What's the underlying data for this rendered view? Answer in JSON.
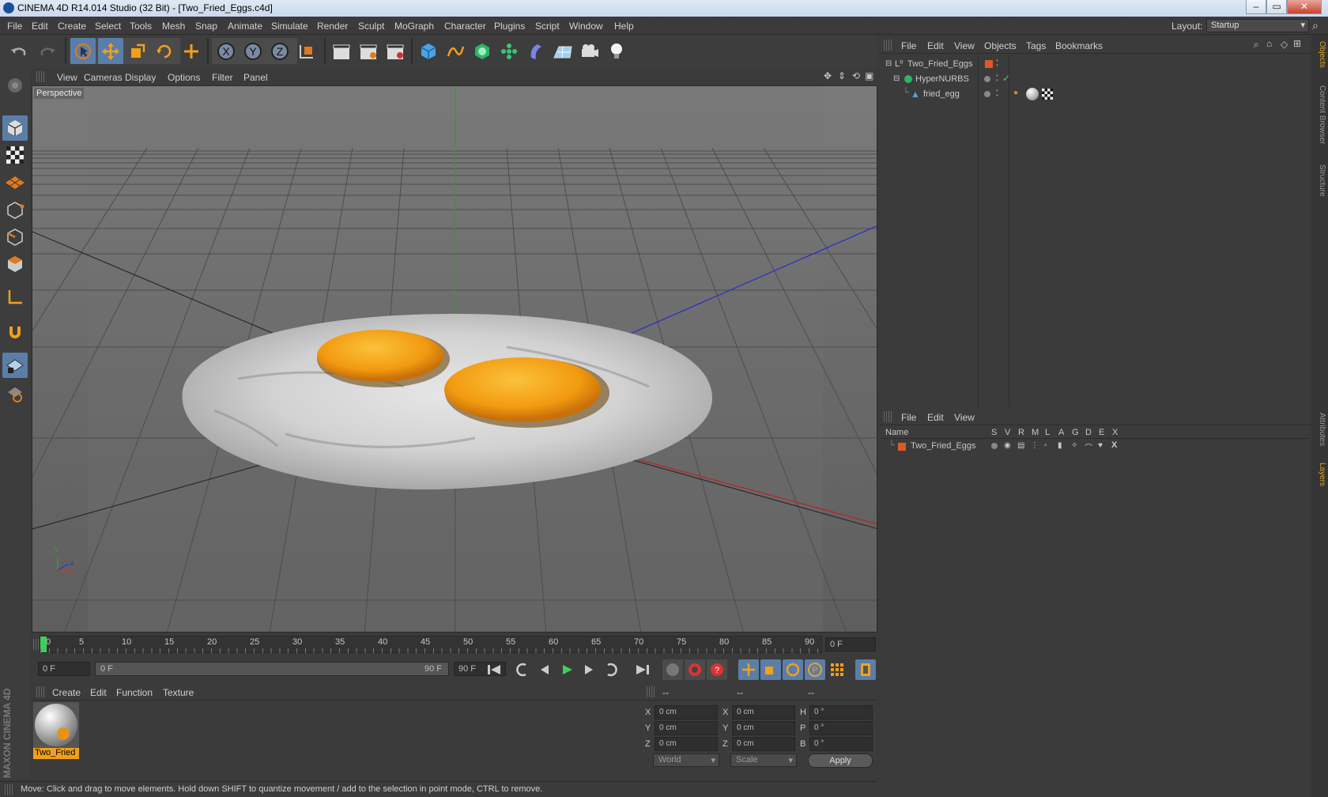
{
  "window": {
    "title": "CINEMA 4D R14.014 Studio (32 Bit) - [Two_Fried_Eggs.c4d]",
    "min": "–",
    "max": "▭",
    "close": "✕"
  },
  "menubar": {
    "items": [
      "File",
      "Edit",
      "Create",
      "Select",
      "Tools",
      "Mesh",
      "Snap",
      "Animate",
      "Simulate",
      "Render",
      "Sculpt",
      "MoGraph",
      "Character",
      "Plugins",
      "Script",
      "Window",
      "Help"
    ],
    "layout_label": "Layout:",
    "layout_value": "Startup"
  },
  "viewport": {
    "menu": [
      "View",
      "Cameras",
      "Display",
      "Options",
      "Filter",
      "Panel"
    ],
    "label": "Perspective",
    "axis": {
      "y": "y",
      "z": "z",
      "x": "x"
    }
  },
  "timeline": {
    "ticks": [
      "0",
      "5",
      "10",
      "15",
      "20",
      "25",
      "30",
      "35",
      "40",
      "45",
      "50",
      "55",
      "60",
      "65",
      "70",
      "75",
      "80",
      "85",
      "90"
    ],
    "current_frame": "0 F",
    "start_field": "0 F",
    "range_start": "0 F",
    "range_end": "90 F",
    "end_field": "90 F"
  },
  "material_manager": {
    "menu": [
      "Create",
      "Edit",
      "Function",
      "Texture"
    ],
    "material_name": "Two_Fried"
  },
  "coordinates": {
    "headers": [
      "--",
      "--",
      "--"
    ],
    "rows": [
      {
        "a": "X",
        "av": "0 cm",
        "b": "X",
        "bv": "0 cm",
        "c": "H",
        "cv": "0 °"
      },
      {
        "a": "Y",
        "av": "0 cm",
        "b": "Y",
        "bv": "0 cm",
        "c": "P",
        "cv": "0 °"
      },
      {
        "a": "Z",
        "av": "0 cm",
        "b": "Z",
        "bv": "0 cm",
        "c": "B",
        "cv": "0 °"
      }
    ],
    "mode": "World",
    "scale": "Scale",
    "apply": "Apply"
  },
  "object_manager": {
    "menu": [
      "File",
      "Edit",
      "View",
      "Objects",
      "Tags",
      "Bookmarks"
    ],
    "objects": [
      {
        "name": "Two_Fried_Eggs"
      },
      {
        "name": "HyperNURBS"
      },
      {
        "name": "fried_egg"
      }
    ]
  },
  "layer_manager": {
    "menu": [
      "File",
      "Edit",
      "View"
    ],
    "columns": [
      "Name",
      "S",
      "V",
      "R",
      "M",
      "L",
      "A",
      "G",
      "D",
      "E",
      "X"
    ],
    "layers": [
      {
        "name": "Two_Fried_Eggs"
      }
    ]
  },
  "right_tabs": [
    "Objects",
    "Content Browser",
    "Structure",
    "Attributes",
    "Layers"
  ],
  "maxon_logo": "MAXON CINEMA 4D",
  "status": "Move: Click and drag to move elements. Hold down SHIFT to quantize movement / add to the selection in point mode, CTRL to remove.",
  "colors": {
    "accent_blue": "#5a7ea8",
    "orange": "#e07a20",
    "yolk": "#f2a019"
  }
}
